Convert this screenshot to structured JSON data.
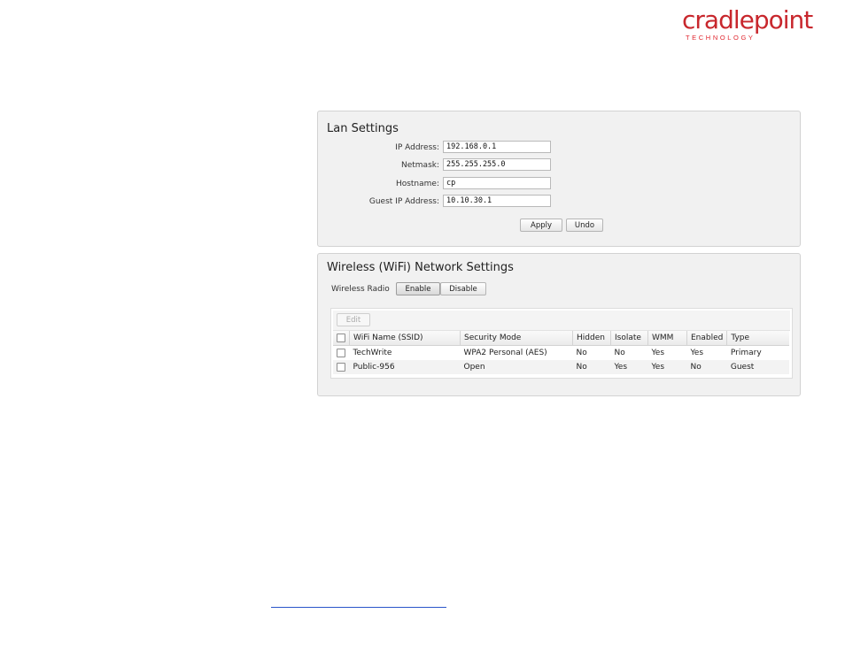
{
  "brand": {
    "name": "cradlepoint",
    "tagline": "TECHNOLOGY",
    "color": "#c8272d"
  },
  "lan": {
    "title": "Lan Settings",
    "fields": [
      {
        "label": "IP Address:",
        "value": "192.168.0.1"
      },
      {
        "label": "Netmask:",
        "value": "255.255.255.0"
      },
      {
        "label": "Hostname:",
        "value": "cp"
      },
      {
        "label": "Guest IP Address:",
        "value": "10.10.30.1"
      }
    ],
    "apply_label": "Apply",
    "undo_label": "Undo"
  },
  "wifi": {
    "title": "Wireless (WiFi) Network Settings",
    "radio_label": "Wireless Radio",
    "enable_label": "Enable",
    "disable_label": "Disable",
    "edit_label": "Edit",
    "columns": [
      "WiFi Name (SSID)",
      "Security Mode",
      "Hidden",
      "Isolate",
      "WMM",
      "Enabled",
      "Type"
    ],
    "rows": [
      [
        "TechWrite",
        "WPA2 Personal (AES)",
        "No",
        "No",
        "Yes",
        "Yes",
        "Primary"
      ],
      [
        "Public-956",
        "Open",
        "No",
        "Yes",
        "Yes",
        "No",
        "Guest"
      ]
    ]
  }
}
